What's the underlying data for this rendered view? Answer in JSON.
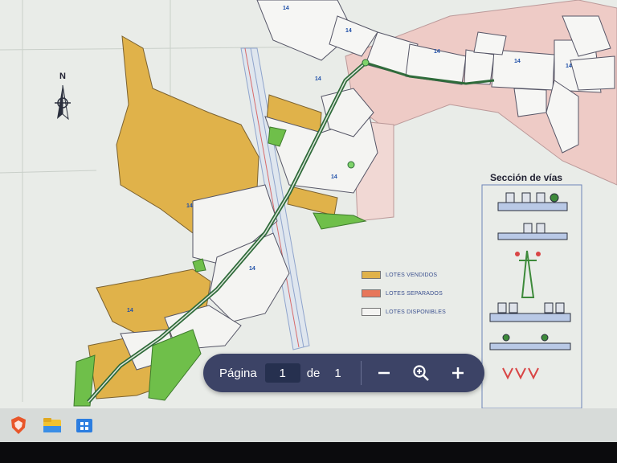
{
  "viewer": {
    "toolbar": {
      "page_label": "Página",
      "current_page": "1",
      "of_label": "de",
      "total_pages": "1",
      "zoom_out_icon": "minus-icon",
      "zoom_fit_icon": "magnifier-plus-icon",
      "zoom_in_icon": "plus-icon"
    }
  },
  "plan": {
    "north_label": "N",
    "sections_title": "Sección de vías",
    "legend": [
      {
        "label": "LOTES VENDIDOS",
        "color": "#e0b24a"
      },
      {
        "label": "LOTES SEPARADOS",
        "color": "#e7765a"
      },
      {
        "label": "LOTES DISPONIBLES",
        "color": "#f4f4f2"
      }
    ],
    "lot_numbers": [
      "14",
      "14",
      "14",
      "14",
      "14",
      "14",
      "14",
      "14",
      "14",
      "14"
    ],
    "colors": {
      "sold": "#e0b24a",
      "separated": "#e7765a",
      "available": "#f4f4f2",
      "pink_zone": "#eecbc6",
      "green_zone": "#6fbf4a",
      "road": "#2f6b3a",
      "river_blue": "#9fb7e0"
    }
  },
  "taskbar": {
    "icons": [
      "brave-browser-icon",
      "file-explorer-icon",
      "windows-store-icon"
    ]
  }
}
